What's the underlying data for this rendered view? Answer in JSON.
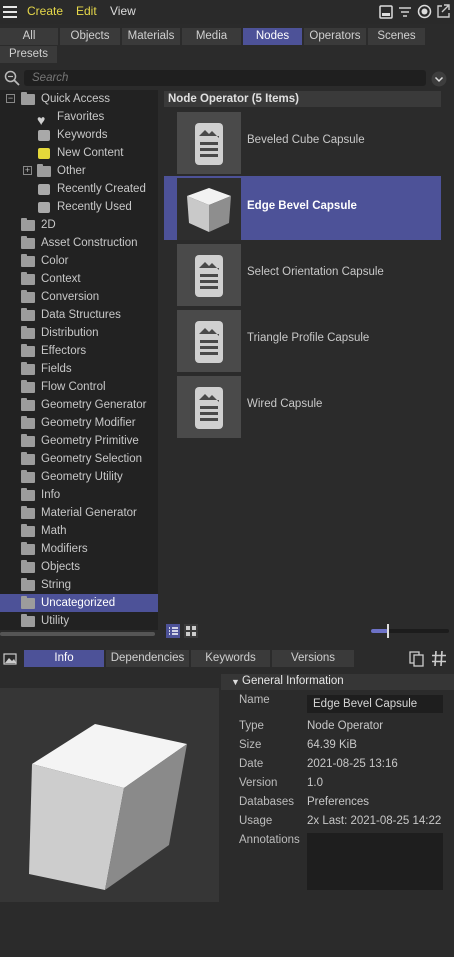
{
  "menubar": {
    "items": [
      "Create",
      "Edit",
      "View"
    ]
  },
  "tabs": [
    "All",
    "Objects",
    "Materials",
    "Media",
    "Nodes",
    "Operators",
    "Scenes",
    "Presets"
  ],
  "active_tab": "Nodes",
  "search": {
    "placeholder": "Search"
  },
  "tree": [
    {
      "label": "Quick Access",
      "type": "folder",
      "expanded": true
    },
    {
      "label": "Favorites",
      "type": "heart"
    },
    {
      "label": "Keywords",
      "type": "search-doc"
    },
    {
      "label": "New Content",
      "type": "search-doc-yellow"
    },
    {
      "label": "Other",
      "type": "folder"
    },
    {
      "label": "Recently Created",
      "type": "search-doc"
    },
    {
      "label": "Recently Used",
      "type": "search-doc"
    },
    {
      "label": "2D",
      "type": "folder"
    },
    {
      "label": "Asset Construction",
      "type": "folder"
    },
    {
      "label": "Color",
      "type": "folder"
    },
    {
      "label": "Context",
      "type": "folder"
    },
    {
      "label": "Conversion",
      "type": "folder"
    },
    {
      "label": "Data Structures",
      "type": "folder"
    },
    {
      "label": "Distribution",
      "type": "folder"
    },
    {
      "label": "Effectors",
      "type": "folder"
    },
    {
      "label": "Fields",
      "type": "folder"
    },
    {
      "label": "Flow Control",
      "type": "folder"
    },
    {
      "label": "Geometry Generator",
      "type": "folder"
    },
    {
      "label": "Geometry Modifier",
      "type": "folder"
    },
    {
      "label": "Geometry Primitive",
      "type": "folder"
    },
    {
      "label": "Geometry Selection",
      "type": "folder"
    },
    {
      "label": "Geometry Utility",
      "type": "folder"
    },
    {
      "label": "Info",
      "type": "folder"
    },
    {
      "label": "Material Generator",
      "type": "folder"
    },
    {
      "label": "Math",
      "type": "folder"
    },
    {
      "label": "Modifiers",
      "type": "folder"
    },
    {
      "label": "Objects",
      "type": "folder"
    },
    {
      "label": "String",
      "type": "folder"
    },
    {
      "label": "Uncategorized",
      "type": "folder",
      "selected": true
    },
    {
      "label": "Utility",
      "type": "folder"
    }
  ],
  "content": {
    "header": "Node Operator (5 Items)",
    "items": [
      {
        "label": "Beveled Cube Capsule",
        "icon": "capsule-icon"
      },
      {
        "label": "Edge Bevel Capsule",
        "icon": "cube-icon",
        "selected": true
      },
      {
        "label": "Select Orientation Capsule",
        "icon": "capsule-icon"
      },
      {
        "label": "Triangle Profile Capsule",
        "icon": "capsule-icon"
      },
      {
        "label": "Wired Capsule",
        "icon": "capsule-icon"
      }
    ]
  },
  "zoom_slider": {
    "value": 0.22
  },
  "lower_tabs": [
    "Info",
    "Dependencies",
    "Keywords",
    "Versions"
  ],
  "active_lower_tab": "Info",
  "info": {
    "section_title": "General Information",
    "name_label": "Name",
    "name_value": "Edge Bevel Capsule",
    "rows": [
      {
        "label": "Type",
        "value": "Node Operator"
      },
      {
        "label": "Size",
        "value": "64.39 KiB"
      },
      {
        "label": "Date",
        "value": "2021-08-25 13:16"
      },
      {
        "label": "Version",
        "value": "1.0"
      },
      {
        "label": "Databases",
        "value": "Preferences"
      },
      {
        "label": "Usage",
        "value": "2x Last: 2021-08-25 14:22"
      }
    ],
    "annotations_label": "Annotations"
  },
  "colors": {
    "accent": "#4d5298",
    "menu_accent": "#e6d84a",
    "background": "#2b2b2b"
  }
}
